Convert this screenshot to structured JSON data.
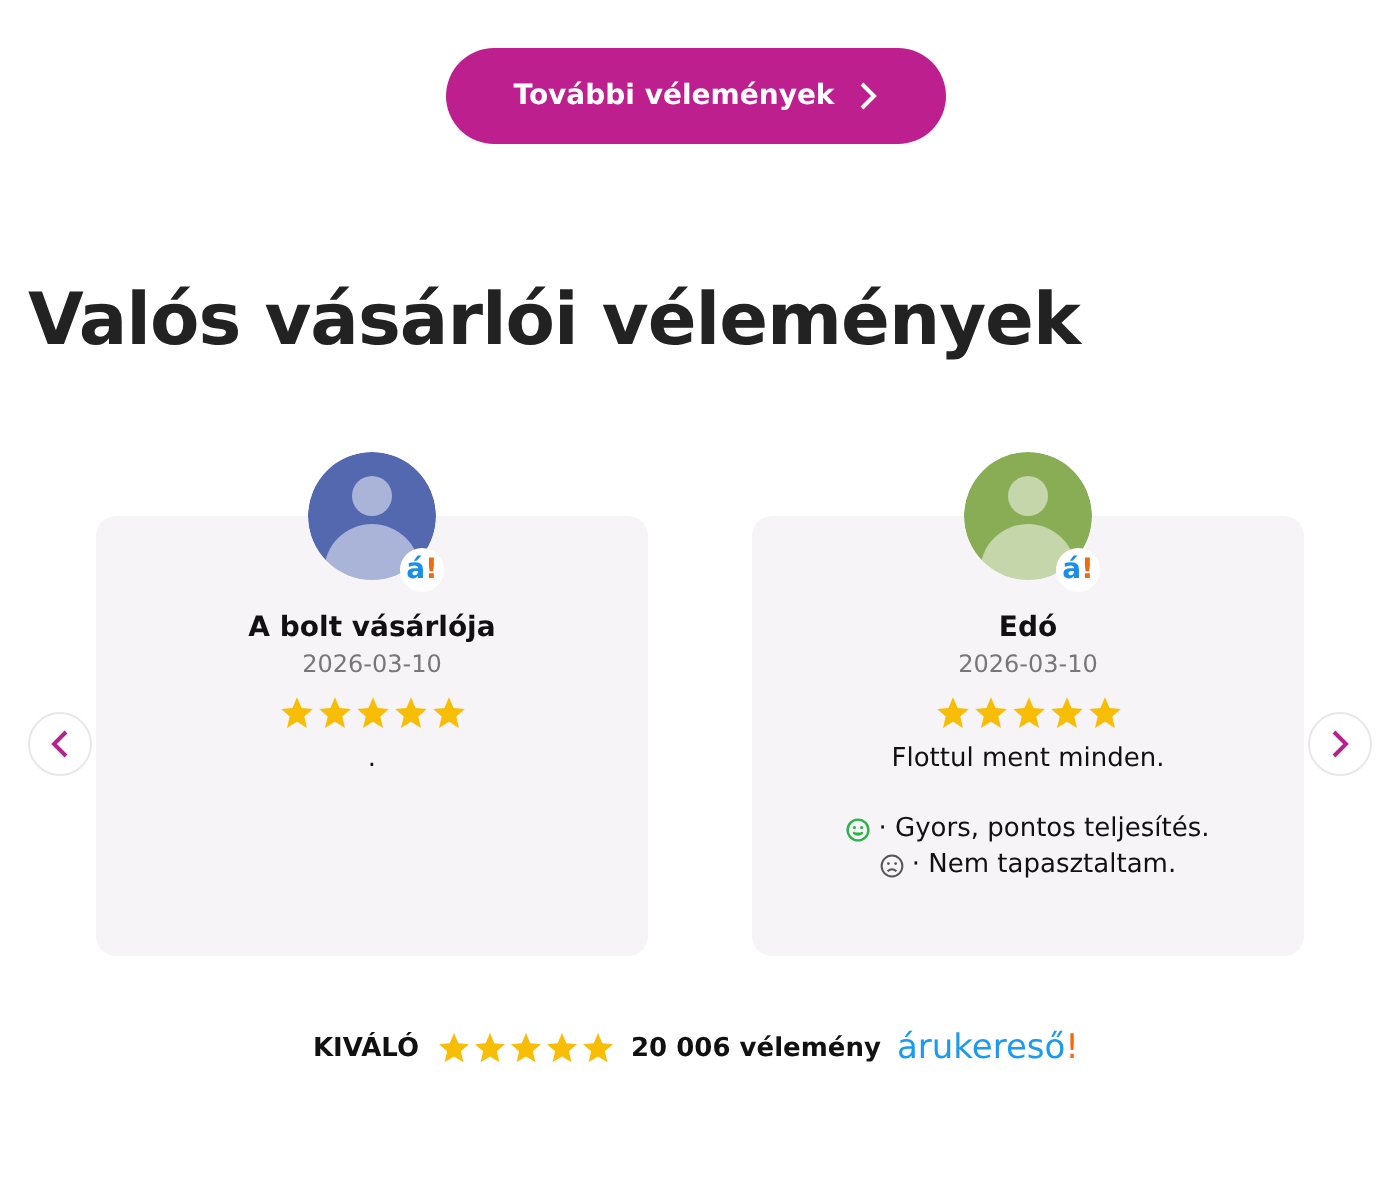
{
  "more_button": {
    "label": "További vélemények"
  },
  "heading": "Valós vásárlói vélemények",
  "reviews": [
    {
      "name": "A bolt vásárlója",
      "date": "2026-03-10",
      "stars": 5,
      "color": "#5468b0",
      "badge": {
        "text": "á",
        "mark": "!"
      },
      "text": "."
    },
    {
      "name": "Edó",
      "date": "2026-03-10",
      "stars": 5,
      "color": "#88ad55",
      "badge": {
        "text": "á",
        "mark": "!"
      },
      "text": "Flottul ment minden.",
      "points": [
        {
          "kind": "pro",
          "text": "· Gyors, pontos teljesítés."
        },
        {
          "kind": "con",
          "text": "· Nem tapasztaltam."
        }
      ]
    }
  ],
  "footer": {
    "rating": "KIVÁLÓ",
    "stars": 5,
    "count": "20 006 vélemény",
    "logo": {
      "text": "árukereső",
      "mark": "!"
    }
  }
}
